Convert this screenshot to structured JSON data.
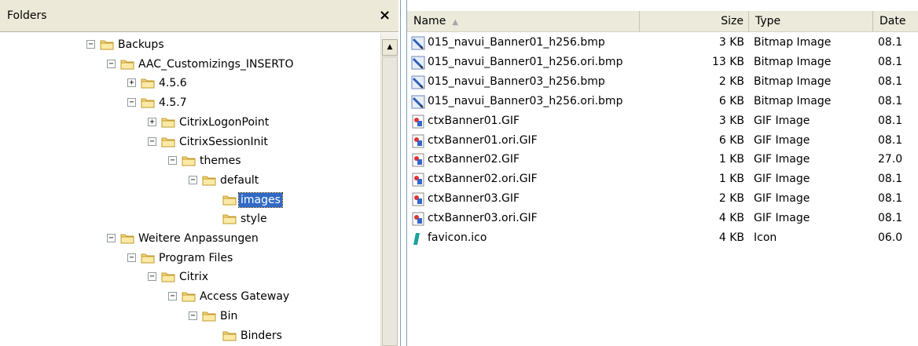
{
  "folders_pane": {
    "title": "Folders",
    "close_symbol": "×",
    "scroll_up_symbol": "▲",
    "tree": [
      {
        "label": "Backups",
        "level": 0,
        "expander": "−",
        "selected": false
      },
      {
        "label": "AAC_Customizings_INSERTO",
        "level": 1,
        "expander": "−",
        "selected": false
      },
      {
        "label": "4.5.6",
        "level": 2,
        "expander": "+",
        "selected": false
      },
      {
        "label": "4.5.7",
        "level": 2,
        "expander": "−",
        "selected": false
      },
      {
        "label": "CitrixLogonPoint",
        "level": 3,
        "expander": "+",
        "selected": false
      },
      {
        "label": "CitrixSessionInit",
        "level": 3,
        "expander": "−",
        "selected": false
      },
      {
        "label": "themes",
        "level": 4,
        "expander": "−",
        "selected": false
      },
      {
        "label": "default",
        "level": 5,
        "expander": "−",
        "selected": false
      },
      {
        "label": "images",
        "level": 6,
        "expander": "",
        "selected": true
      },
      {
        "label": "style",
        "level": 6,
        "expander": "",
        "selected": false
      },
      {
        "label": "Weitere Anpassungen",
        "level": 1,
        "expander": "−",
        "selected": false
      },
      {
        "label": "Program Files",
        "level": 2,
        "expander": "−",
        "selected": false
      },
      {
        "label": "Citrix",
        "level": 3,
        "expander": "−",
        "selected": false
      },
      {
        "label": "Access Gateway",
        "level": 4,
        "expander": "−",
        "selected": false
      },
      {
        "label": "Bin",
        "level": 5,
        "expander": "−",
        "selected": false
      },
      {
        "label": "Binders",
        "level": 6,
        "expander": "",
        "selected": false
      }
    ]
  },
  "file_list": {
    "columns": {
      "name": "Name",
      "name_sort_indicator": "▲",
      "size": "Size",
      "type": "Type",
      "date": "Date"
    },
    "files": [
      {
        "name": "015_navui_Banner01_h256.bmp",
        "size": "3 KB",
        "type": "Bitmap Image",
        "date": "08.1",
        "icon": "bitmap-icon"
      },
      {
        "name": "015_navui_Banner01_h256.ori.bmp",
        "size": "13 KB",
        "type": "Bitmap Image",
        "date": "08.1",
        "icon": "bitmap-icon"
      },
      {
        "name": "015_navui_Banner03_h256.bmp",
        "size": "2 KB",
        "type": "Bitmap Image",
        "date": "08.1",
        "icon": "bitmap-icon"
      },
      {
        "name": "015_navui_Banner03_h256.ori.bmp",
        "size": "6 KB",
        "type": "Bitmap Image",
        "date": "08.1",
        "icon": "bitmap-icon"
      },
      {
        "name": "ctxBanner01.GIF",
        "size": "3 KB",
        "type": "GIF Image",
        "date": "08.1",
        "icon": "gif-icon"
      },
      {
        "name": "ctxBanner01.ori.GIF",
        "size": "6 KB",
        "type": "GIF Image",
        "date": "08.1",
        "icon": "gif-icon"
      },
      {
        "name": "ctxBanner02.GIF",
        "size": "1 KB",
        "type": "GIF Image",
        "date": "27.0",
        "icon": "gif-icon"
      },
      {
        "name": "ctxBanner02.ori.GIF",
        "size": "1 KB",
        "type": "GIF Image",
        "date": "08.1",
        "icon": "gif-icon"
      },
      {
        "name": "ctxBanner03.GIF",
        "size": "2 KB",
        "type": "GIF Image",
        "date": "08.1",
        "icon": "gif-icon"
      },
      {
        "name": "ctxBanner03.ori.GIF",
        "size": "4 KB",
        "type": "GIF Image",
        "date": "08.1",
        "icon": "gif-icon"
      },
      {
        "name": "favicon.ico",
        "size": "4 KB",
        "type": "Icon",
        "date": "06.0",
        "icon": "ico-file-icon"
      }
    ]
  },
  "colors": {
    "selection": "#316ac5",
    "folder_fill": "#f5d77b",
    "header_bg": "#ebeadb"
  }
}
